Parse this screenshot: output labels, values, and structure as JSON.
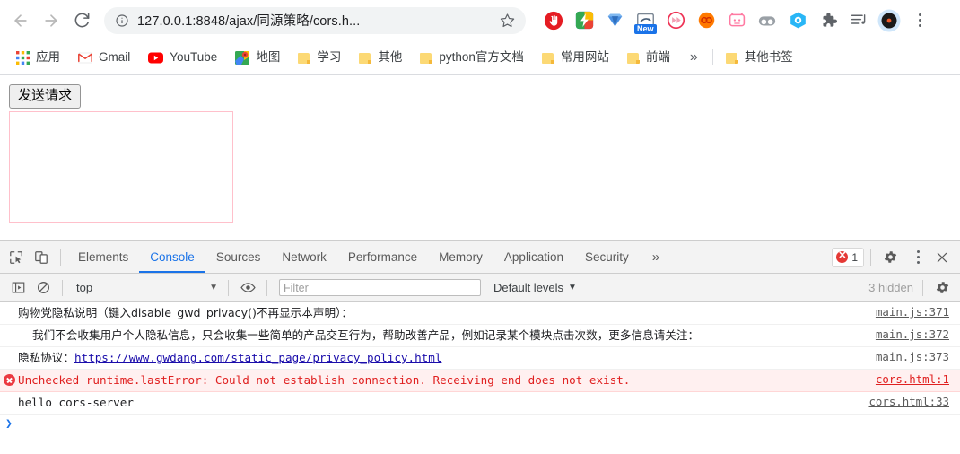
{
  "browser": {
    "nav": {
      "back_label": "Back",
      "forward_label": "Forward",
      "reload_label": "Reload"
    },
    "omnibox": {
      "url": "127.0.0.1:8848/ajax/同源策略/cors.h...",
      "info_icon": "info-circle-icon",
      "star_icon": "bookmark-star-icon"
    },
    "extensions": [
      {
        "name": "adblock-extension-icon"
      },
      {
        "name": "lightning-color-extension-icon"
      },
      {
        "name": "diamond-extension-icon"
      },
      {
        "name": "screenshot-extension-icon",
        "badge": "New"
      },
      {
        "name": "fast-forward-extension-icon"
      },
      {
        "name": "infinity-extension-icon"
      },
      {
        "name": "bilibili-tv-extension-icon"
      },
      {
        "name": "goggles-extension-icon"
      },
      {
        "name": "hexagon-o-extension-icon"
      },
      {
        "name": "puzzle-extensions-icon"
      },
      {
        "name": "music-playlist-extension-icon"
      },
      {
        "name": "vinyl-record-extension-icon"
      }
    ],
    "menu_icon": "chrome-menu-kebab-icon"
  },
  "bookmarks": {
    "items": [
      {
        "label": "应用",
        "icon": "apps-grid-icon"
      },
      {
        "label": "Gmail",
        "icon": "gmail-icon"
      },
      {
        "label": "YouTube",
        "icon": "youtube-icon"
      },
      {
        "label": "地图",
        "icon": "google-maps-icon"
      },
      {
        "label": "学习",
        "icon": "folder-icon"
      },
      {
        "label": "其他",
        "icon": "folder-icon"
      },
      {
        "label": "python官方文档",
        "icon": "folder-icon"
      },
      {
        "label": "常用网站",
        "icon": "folder-icon"
      },
      {
        "label": "前端",
        "icon": "folder-icon"
      }
    ],
    "overflow": "»",
    "other_bookmarks": {
      "label": "其他书签",
      "icon": "folder-icon"
    }
  },
  "page": {
    "send_button_label": "发送请求",
    "result_box_placeholder": "",
    "result_box_border_color": "#ffc0cb"
  },
  "devtools": {
    "tabs": [
      {
        "label": "Elements",
        "active": false
      },
      {
        "label": "Console",
        "active": true
      },
      {
        "label": "Sources",
        "active": false
      },
      {
        "label": "Network",
        "active": false
      },
      {
        "label": "Performance",
        "active": false
      },
      {
        "label": "Memory",
        "active": false
      },
      {
        "label": "Application",
        "active": false
      },
      {
        "label": "Security",
        "active": false
      }
    ],
    "more_tabs": "»",
    "inspect_icon": "inspect-element-icon",
    "device_toolbar_icon": "device-toolbar-icon",
    "error_count": "1",
    "settings_icon": "gear-icon",
    "kebab_icon": "more-options-kebab-icon",
    "close_icon": "close-icon",
    "accent_color": "#1a73e8",
    "error_color": "#e02020",
    "filterbar": {
      "sidebar_icon": "console-sidebar-icon",
      "clear_icon": "clear-console-icon",
      "context": "top",
      "eye_icon": "live-expression-eye-icon",
      "filter_placeholder": "Filter",
      "filter_value": "",
      "levels": "Default levels",
      "hidden": "3 hidden",
      "settings_icon": "console-settings-gear-icon"
    },
    "messages": [
      {
        "type": "log",
        "text": "购物党隐私说明（键入disable_gwd_privacy()不再显示本声明）：",
        "source": "main.js:371"
      },
      {
        "type": "log",
        "text": "    我们不会收集用户个人隐私信息，只会收集一些简单的产品交互行为，帮助改善产品，例如记录某个模块点击次数，更多信息请关注：",
        "source": "main.js:372"
      },
      {
        "type": "log",
        "text_prefix": "隐私协议：",
        "link": "https://www.gwdang.com/static_page/privacy_policy.html",
        "source": "main.js:373"
      },
      {
        "type": "error",
        "text": "Unchecked runtime.lastError: Could not establish connection. Receiving end does not exist.",
        "source": "cors.html:1"
      },
      {
        "type": "log",
        "text": "hello cors-server",
        "source": "cors.html:33"
      }
    ],
    "prompt_caret": "❯"
  }
}
